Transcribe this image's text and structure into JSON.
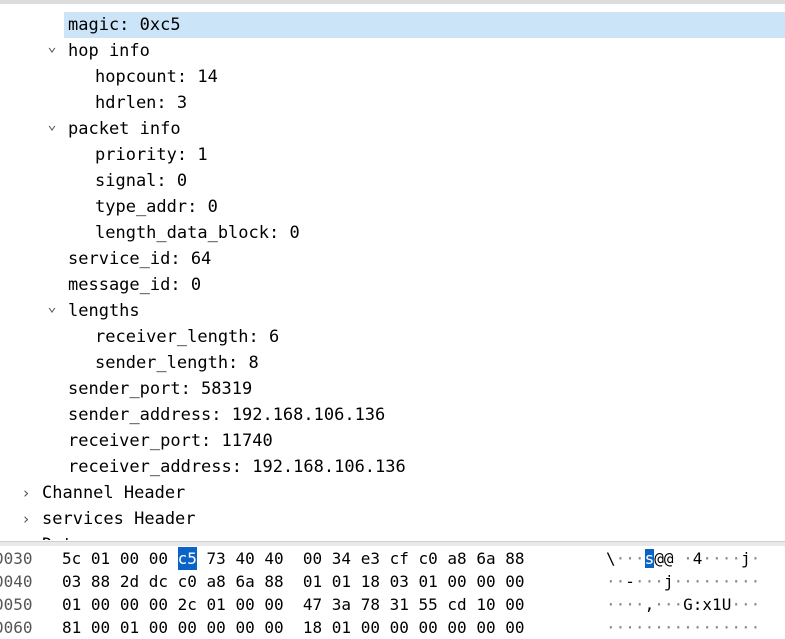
{
  "tree": [
    {
      "text": "magic: 0xc5",
      "indent": 2,
      "selected": true,
      "expander": ""
    },
    {
      "text": "hop info",
      "indent": 2,
      "selected": false,
      "expander": "open"
    },
    {
      "text": "hopcount: 14",
      "indent": 3,
      "selected": false,
      "expander": ""
    },
    {
      "text": "hdrlen: 3",
      "indent": 3,
      "selected": false,
      "expander": ""
    },
    {
      "text": "packet info",
      "indent": 2,
      "selected": false,
      "expander": "open"
    },
    {
      "text": "priority: 1",
      "indent": 3,
      "selected": false,
      "expander": ""
    },
    {
      "text": "signal: 0",
      "indent": 3,
      "selected": false,
      "expander": ""
    },
    {
      "text": "type_addr: 0",
      "indent": 3,
      "selected": false,
      "expander": ""
    },
    {
      "text": "length_data_block: 0",
      "indent": 3,
      "selected": false,
      "expander": ""
    },
    {
      "text": "service_id: 64",
      "indent": 2,
      "selected": false,
      "expander": ""
    },
    {
      "text": "message_id: 0",
      "indent": 2,
      "selected": false,
      "expander": ""
    },
    {
      "text": "lengths",
      "indent": 2,
      "selected": false,
      "expander": "open"
    },
    {
      "text": "receiver_length: 6",
      "indent": 3,
      "selected": false,
      "expander": ""
    },
    {
      "text": "sender_length: 8",
      "indent": 3,
      "selected": false,
      "expander": ""
    },
    {
      "text": "sender_port: 58319",
      "indent": 2,
      "selected": false,
      "expander": ""
    },
    {
      "text": "sender_address: 192.168.106.136",
      "indent": 2,
      "selected": false,
      "expander": ""
    },
    {
      "text": "receiver_port: 11740",
      "indent": 2,
      "selected": false,
      "expander": ""
    },
    {
      "text": "receiver_address: 192.168.106.136",
      "indent": 2,
      "selected": false,
      "expander": ""
    },
    {
      "text": "Channel Header",
      "indent": 1,
      "selected": false,
      "expander": "closed"
    },
    {
      "text": "services Header",
      "indent": 1,
      "selected": false,
      "expander": "closed"
    },
    {
      "text": "Data",
      "indent": 1,
      "selected": false,
      "expander": "closed"
    }
  ],
  "hex": [
    {
      "offset": "0030",
      "bytes": [
        "5c",
        "01",
        "00",
        "00",
        "c5",
        "73",
        "40",
        "40",
        "00",
        "34",
        "e3",
        "cf",
        "c0",
        "a8",
        "6a",
        "88"
      ],
      "selected_byte": 4,
      "ascii": "\\···s@@ ·4····j·",
      "ascii_selected_index": 4
    },
    {
      "offset": "0040",
      "bytes": [
        "03",
        "88",
        "2d",
        "dc",
        "c0",
        "a8",
        "6a",
        "88",
        "01",
        "01",
        "18",
        "03",
        "01",
        "00",
        "00",
        "00"
      ],
      "selected_byte": -1,
      "ascii": "··-···j·········",
      "ascii_selected_index": -1
    },
    {
      "offset": "0050",
      "bytes": [
        "01",
        "00",
        "00",
        "00",
        "2c",
        "01",
        "00",
        "00",
        "47",
        "3a",
        "78",
        "31",
        "55",
        "cd",
        "10",
        "00"
      ],
      "selected_byte": -1,
      "ascii": "····,···G:x1U···",
      "ascii_selected_index": -1
    },
    {
      "offset": "0060",
      "bytes": [
        "81",
        "00",
        "01",
        "00",
        "00",
        "00",
        "00",
        "00",
        "18",
        "01",
        "00",
        "00",
        "00",
        "00",
        "00",
        "00"
      ],
      "selected_byte": -1,
      "ascii": "················",
      "ascii_selected_index": -1
    }
  ],
  "colors": {
    "selection_row": "#cce4f7",
    "selected_byte": "#0a64c8"
  },
  "icons": {
    "expanded": "chevron-down-icon",
    "collapsed": "chevron-right-icon"
  }
}
